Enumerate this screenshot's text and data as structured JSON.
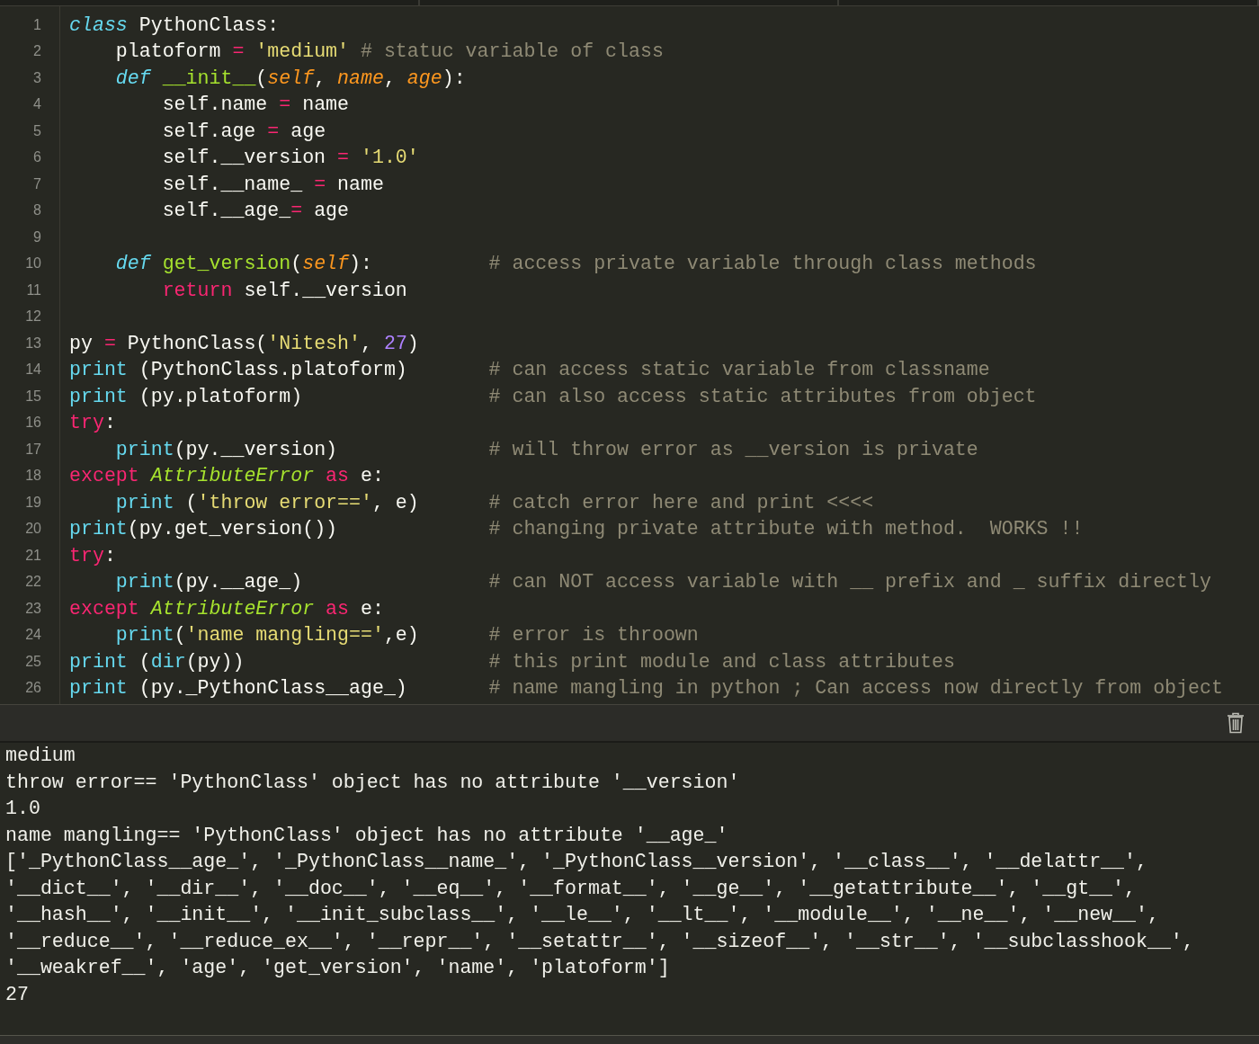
{
  "editor": {
    "lines": [
      {
        "number": "1",
        "tokens": [
          {
            "kind": "st",
            "t": "class "
          },
          {
            "kind": "p",
            "t": "PythonClass:"
          }
        ],
        "children": [
          {
            "number": "2",
            "tokens": [
              {
                "kind": "p",
                "t": "platoform "
              },
              {
                "kind": "op",
                "t": "= "
              },
              {
                "kind": "s",
                "t": "'medium' "
              },
              {
                "kind": "c",
                "t": "# statuc variable of class"
              }
            ]
          },
          {
            "number": "3",
            "tokens": [
              {
                "kind": "st",
                "t": "def "
              },
              {
                "kind": "fn",
                "t": "__init__"
              },
              {
                "kind": "p",
                "t": "("
              },
              {
                "kind": "pa",
                "t": "self"
              },
              {
                "kind": "p",
                "t": ", "
              },
              {
                "kind": "pa",
                "t": "name"
              },
              {
                "kind": "p",
                "t": ", "
              },
              {
                "kind": "pa",
                "t": "age"
              },
              {
                "kind": "p",
                "t": "):"
              }
            ],
            "children": [
              {
                "number": "4",
                "tokens": [
                  {
                    "kind": "p",
                    "t": "self.name "
                  },
                  {
                    "kind": "op",
                    "t": "= "
                  },
                  {
                    "kind": "p",
                    "t": "name"
                  }
                ]
              },
              {
                "number": "5",
                "tokens": [
                  {
                    "kind": "p",
                    "t": "self.age "
                  },
                  {
                    "kind": "op",
                    "t": "= "
                  },
                  {
                    "kind": "p",
                    "t": "age"
                  }
                ]
              },
              {
                "number": "6",
                "tokens": [
                  {
                    "kind": "p",
                    "t": "self.__version "
                  },
                  {
                    "kind": "op",
                    "t": "= "
                  },
                  {
                    "kind": "s",
                    "t": "'1.0'"
                  }
                ]
              },
              {
                "number": "7",
                "tokens": [
                  {
                    "kind": "p",
                    "t": "self.__name_ "
                  },
                  {
                    "kind": "op",
                    "t": "= "
                  },
                  {
                    "kind": "p",
                    "t": "name"
                  }
                ]
              },
              {
                "number": "8",
                "tokens": [
                  {
                    "kind": "p",
                    "t": "self.__age_"
                  },
                  {
                    "kind": "op",
                    "t": "= "
                  },
                  {
                    "kind": "p",
                    "t": "age"
                  }
                ]
              }
            ]
          },
          {
            "number": "9"
          },
          {
            "number": "10",
            "tokens": [
              {
                "kind": "st",
                "t": "def "
              },
              {
                "kind": "fn",
                "t": "get_version"
              },
              {
                "kind": "p",
                "t": "("
              },
              {
                "kind": "pa",
                "t": "self"
              },
              {
                "kind": "p",
                "t": "):"
              }
            ],
            "comment": "# access private variable through class methods",
            "children": [
              {
                "number": "11",
                "tokens": [
                  {
                    "kind": "kw",
                    "t": "return "
                  },
                  {
                    "kind": "p",
                    "t": "self.__version"
                  }
                ]
              }
            ]
          }
        ]
      },
      {
        "number": "12"
      },
      {
        "number": "13",
        "tokens": [
          {
            "kind": "p",
            "t": "py "
          },
          {
            "kind": "op",
            "t": "= "
          },
          {
            "kind": "p",
            "t": "PythonClass("
          },
          {
            "kind": "s",
            "t": "'Nitesh'"
          },
          {
            "kind": "p",
            "t": ", "
          },
          {
            "kind": "n",
            "t": "27"
          },
          {
            "kind": "p",
            "t": ")"
          }
        ]
      },
      {
        "number": "14",
        "tokens": [
          {
            "kind": "bi",
            "t": "print "
          },
          {
            "kind": "p",
            "t": "(PythonClass.platoform)"
          }
        ],
        "comment": "# can access static variable from classname"
      },
      {
        "number": "15",
        "tokens": [
          {
            "kind": "bi",
            "t": "print "
          },
          {
            "kind": "p",
            "t": "(py.platoform)"
          }
        ],
        "comment": "# can also access static attributes from object"
      },
      {
        "number": "16",
        "tokens": [
          {
            "kind": "kw",
            "t": "try"
          },
          {
            "kind": "p",
            "t": ":"
          }
        ],
        "children": [
          {
            "number": "17",
            "tokens": [
              {
                "kind": "bi",
                "t": "print"
              },
              {
                "kind": "p",
                "t": "(py.__version)"
              }
            ],
            "comment": "# will throw error as __version is private"
          }
        ]
      },
      {
        "number": "18",
        "tokens": [
          {
            "kind": "kw",
            "t": "except "
          },
          {
            "kind": "ty",
            "t": "AttributeError "
          },
          {
            "kind": "kw",
            "t": "as "
          },
          {
            "kind": "p",
            "t": "e:"
          }
        ],
        "children": [
          {
            "number": "19",
            "tokens": [
              {
                "kind": "bi",
                "t": "print "
              },
              {
                "kind": "p",
                "t": "("
              },
              {
                "kind": "s",
                "t": "'throw error=='"
              },
              {
                "kind": "p",
                "t": ", e)"
              }
            ],
            "comment": "# catch error here and print <<<<"
          }
        ]
      },
      {
        "number": "20",
        "tokens": [
          {
            "kind": "bi",
            "t": "print"
          },
          {
            "kind": "p",
            "t": "(py.get_version())"
          }
        ],
        "comment": "# changing private attribute with method.  WORKS !!"
      },
      {
        "number": "21",
        "tokens": [
          {
            "kind": "kw",
            "t": "try"
          },
          {
            "kind": "p",
            "t": ":"
          }
        ],
        "children": [
          {
            "number": "22",
            "tokens": [
              {
                "kind": "bi",
                "t": "print"
              },
              {
                "kind": "p",
                "t": "(py.__age_)"
              }
            ],
            "comment": "# can NOT access variable with __ prefix and _ suffix directly"
          }
        ]
      },
      {
        "number": "23",
        "tokens": [
          {
            "kind": "kw",
            "t": "except "
          },
          {
            "kind": "ty",
            "t": "AttributeError "
          },
          {
            "kind": "kw",
            "t": "as "
          },
          {
            "kind": "p",
            "t": "e:"
          }
        ],
        "children": [
          {
            "number": "24",
            "tokens": [
              {
                "kind": "bi",
                "t": "print"
              },
              {
                "kind": "p",
                "t": "("
              },
              {
                "kind": "s",
                "t": "'name mangling=='"
              },
              {
                "kind": "p",
                "t": ",e)"
              }
            ],
            "comment": "# error is throown"
          }
        ]
      },
      {
        "number": "25",
        "tokens": [
          {
            "kind": "bi",
            "t": "print "
          },
          {
            "kind": "p",
            "t": "("
          },
          {
            "kind": "bi",
            "t": "dir"
          },
          {
            "kind": "p",
            "t": "(py))"
          }
        ],
        "comment": "# this print module and class attributes"
      },
      {
        "number": "26",
        "tokens": [
          {
            "kind": "bi",
            "t": "print "
          },
          {
            "kind": "p",
            "t": "(py._PythonClass__age_)"
          }
        ],
        "comment": "# name mangling in python ; Can access now directly from object"
      }
    ]
  },
  "console": {
    "lines": [
      "medium",
      "throw error== 'PythonClass' object has no attribute '__version'",
      "1.0",
      "name mangling== 'PythonClass' object has no attribute '__age_'",
      "['_PythonClass__age_', '_PythonClass__name_', '_PythonClass__version', '__class__', '__delattr__',",
      "'__dict__', '__dir__', '__doc__', '__eq__', '__format__', '__ge__', '__getattribute__', '__gt__',",
      "'__hash__', '__init__', '__init_subclass__', '__le__', '__lt__', '__module__', '__ne__', '__new__',",
      "'__reduce__', '__reduce_ex__', '__repr__', '__setattr__', '__sizeof__', '__str__', '__subclasshook__',",
      "'__weakref__', 'age', 'get_version', 'name', 'platoform']",
      "27"
    ]
  }
}
